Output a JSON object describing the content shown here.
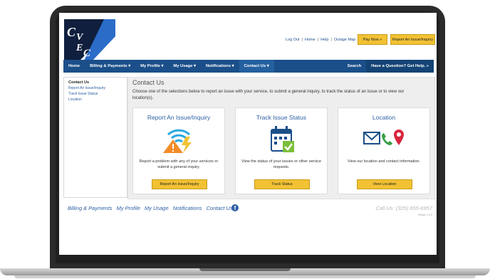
{
  "header": {
    "logo_text": "CVEC",
    "links": [
      "Log Out",
      "Home",
      "Help",
      "Outage Map"
    ],
    "pay_now": "Pay Now »",
    "report_issue": "Report An Issue/Inquiry"
  },
  "nav": {
    "items": [
      "Home",
      "Billing & Payments ▾",
      "My Profile ▾",
      "My Usage ▾",
      "Notifications ▾",
      "Contact Us ▾"
    ],
    "search": "Search",
    "question": "Have a Question? Get Help. »"
  },
  "sidebar": {
    "title": "Contact Us",
    "links": [
      "Report An Issue/Inquiry",
      "Track Issue Status",
      "Location"
    ]
  },
  "main": {
    "title": "Contact Us",
    "description": "Choose one of the selections below to report an issue with your service, to submit a general inquiry, to track the status of an issue or to view our location(s).",
    "cards": [
      {
        "title": "Report An Issue/Inquiry",
        "text": "Report a problem with any of your services or submit a general inquiry.",
        "button": "Report An Issue/Inquiry",
        "icon": "warning-wifi-icon"
      },
      {
        "title": "Track Issue Status",
        "text": "View the status of your issues or other service requests.",
        "button": "Track Status",
        "icon": "calendar-check-icon"
      },
      {
        "title": "Location",
        "text": "View our location and contact information.",
        "button": "View Location",
        "icon": "contact-location-icon"
      }
    ]
  },
  "footer": {
    "links": [
      "Billing & Payments",
      "My Profile",
      "My Usage",
      "Notifications",
      "Contact Us"
    ],
    "call": "Call Us: (325) 655-6957",
    "version": "Version 1.0.0"
  },
  "colors": {
    "nav": "#1b4f8a",
    "accent": "#f2c233",
    "link": "#2c5fa3"
  }
}
